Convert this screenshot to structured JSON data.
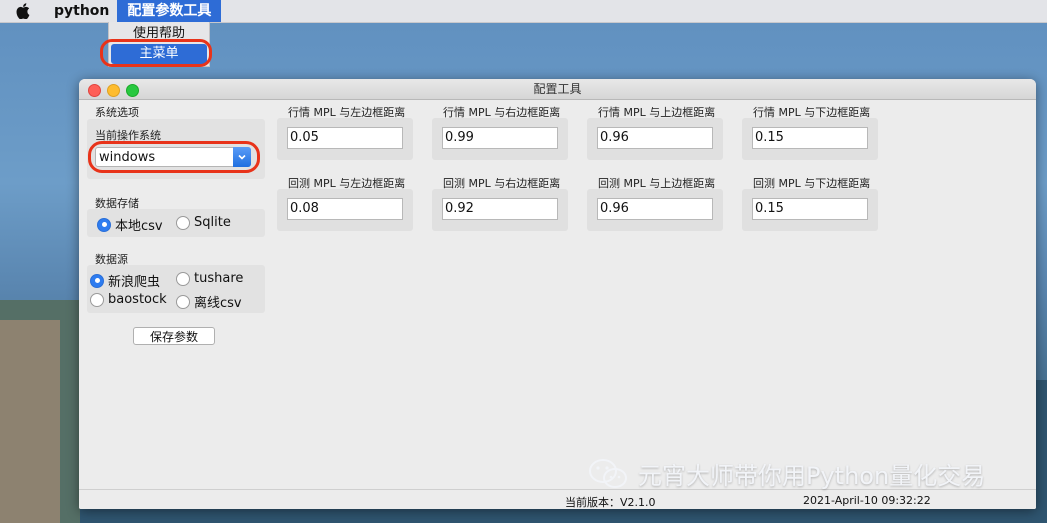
{
  "menubar": {
    "app_name": "python",
    "menu_tools": "配置参数工具"
  },
  "dropdown": {
    "items": [
      "使用帮助",
      "主菜单"
    ]
  },
  "window": {
    "title": "配置工具",
    "system_section": "系统选项",
    "current_os_label": "当前操作系统",
    "os_value": "windows",
    "storage_label": "数据存储",
    "storage_options": [
      "本地csv",
      "Sqlite"
    ],
    "storage_selected": "本地csv",
    "datasource_label": "数据源",
    "datasource_options": [
      "新浪爬虫",
      "tushare",
      "baostock",
      "离线csv"
    ],
    "datasource_selected": "新浪爬虫",
    "save_button": "保存参数",
    "params": [
      {
        "label": "行情 MPL 与左边框距离",
        "value": "0.05"
      },
      {
        "label": "行情 MPL 与右边框距离",
        "value": "0.99"
      },
      {
        "label": "行情 MPL 与上边框距离",
        "value": "0.96"
      },
      {
        "label": "行情 MPL 与下边框距离",
        "value": "0.15"
      },
      {
        "label": "回测 MPL 与左边框距离",
        "value": "0.08"
      },
      {
        "label": "回测 MPL 与右边框距离",
        "value": "0.92"
      },
      {
        "label": "回测 MPL 与上边框距离",
        "value": "0.96"
      },
      {
        "label": "回测 MPL 与下边框距离",
        "value": "0.15"
      }
    ],
    "status_version": "当前版本：V2.1.0",
    "status_datetime": "2021-April-10 09:32:22"
  },
  "watermark": "元宵大师带你用Python量化交易",
  "colors": {
    "accent": "#2e6cd6",
    "highlight_ring": "#e8331a"
  }
}
